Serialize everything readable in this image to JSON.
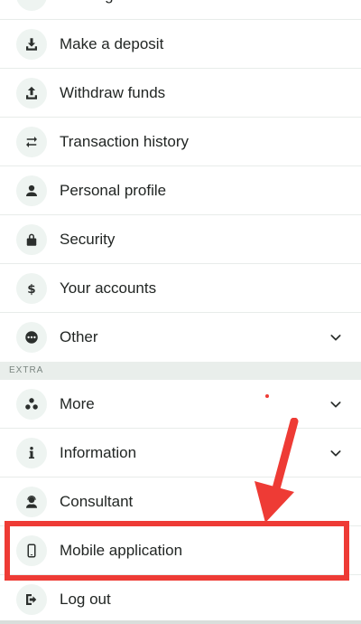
{
  "colors": {
    "icon_bg": "#eef4f1",
    "icon_fg": "#2b2f2d",
    "divider": "#e8ecea",
    "section_bg": "#e9eeeb",
    "annotation": "#ee3b35"
  },
  "menu": {
    "top_item": {
      "label": "Messages",
      "icon": "mail-icon"
    },
    "items": [
      {
        "label": "Make a deposit",
        "icon": "download-tray-icon"
      },
      {
        "label": "Withdraw funds",
        "icon": "upload-tray-icon"
      },
      {
        "label": "Transaction history",
        "icon": "swap-arrows-icon"
      },
      {
        "label": "Personal profile",
        "icon": "person-icon"
      },
      {
        "label": "Security",
        "icon": "lock-icon"
      },
      {
        "label": "Your accounts",
        "icon": "dollar-icon"
      },
      {
        "label": "Other",
        "icon": "more-dots-icon",
        "expandable": true
      }
    ]
  },
  "extra": {
    "header": "EXTRA",
    "items": [
      {
        "label": "More",
        "icon": "three-circles-icon",
        "expandable": true
      },
      {
        "label": "Information",
        "icon": "info-icon",
        "expandable": true
      },
      {
        "label": "Consultant",
        "icon": "headset-person-icon"
      },
      {
        "label": "Mobile application",
        "icon": "smartphone-icon"
      },
      {
        "label": "Log out",
        "icon": "logout-icon"
      }
    ]
  }
}
